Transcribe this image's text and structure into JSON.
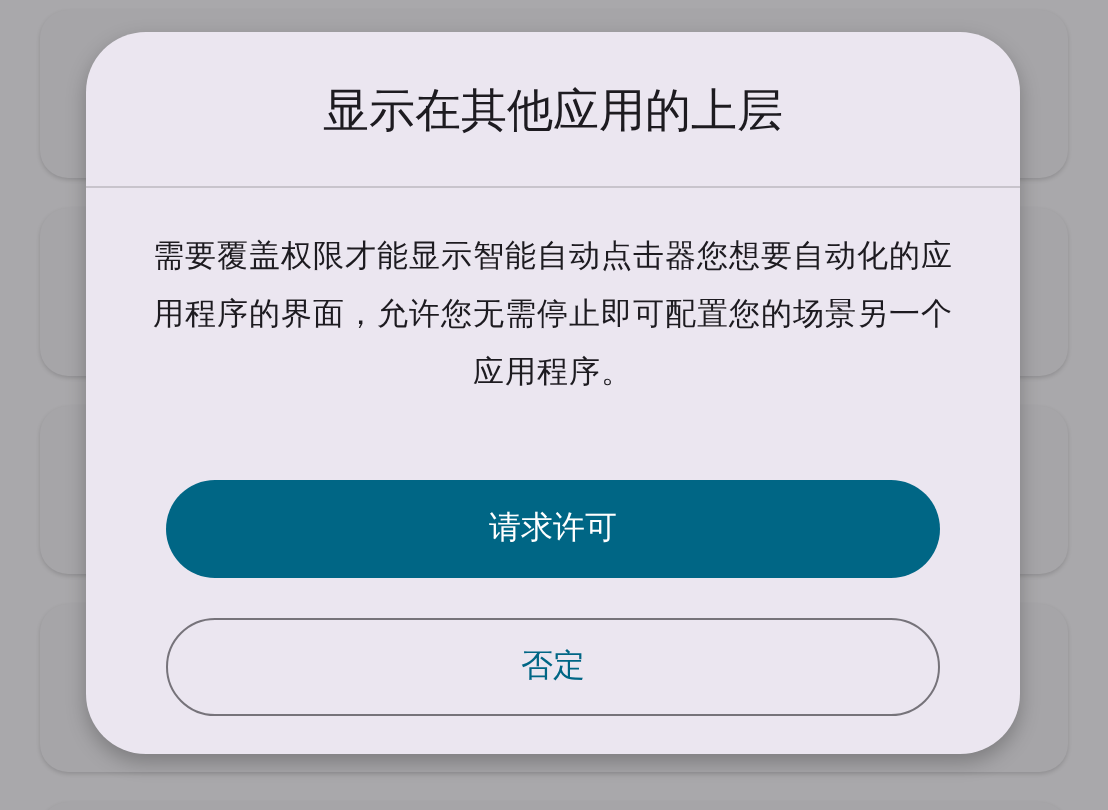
{
  "dialog": {
    "title": "显示在其他应用的上层",
    "message": "需要覆盖权限才能显示智能自动点击器您想要自动化的应用程序的界面，允许您无需停止即可配置您的场景另一个应用程序。",
    "buttons": [
      {
        "label": "请求许可",
        "kind": "primary"
      },
      {
        "label": "否定",
        "kind": "outlined"
      }
    ]
  }
}
